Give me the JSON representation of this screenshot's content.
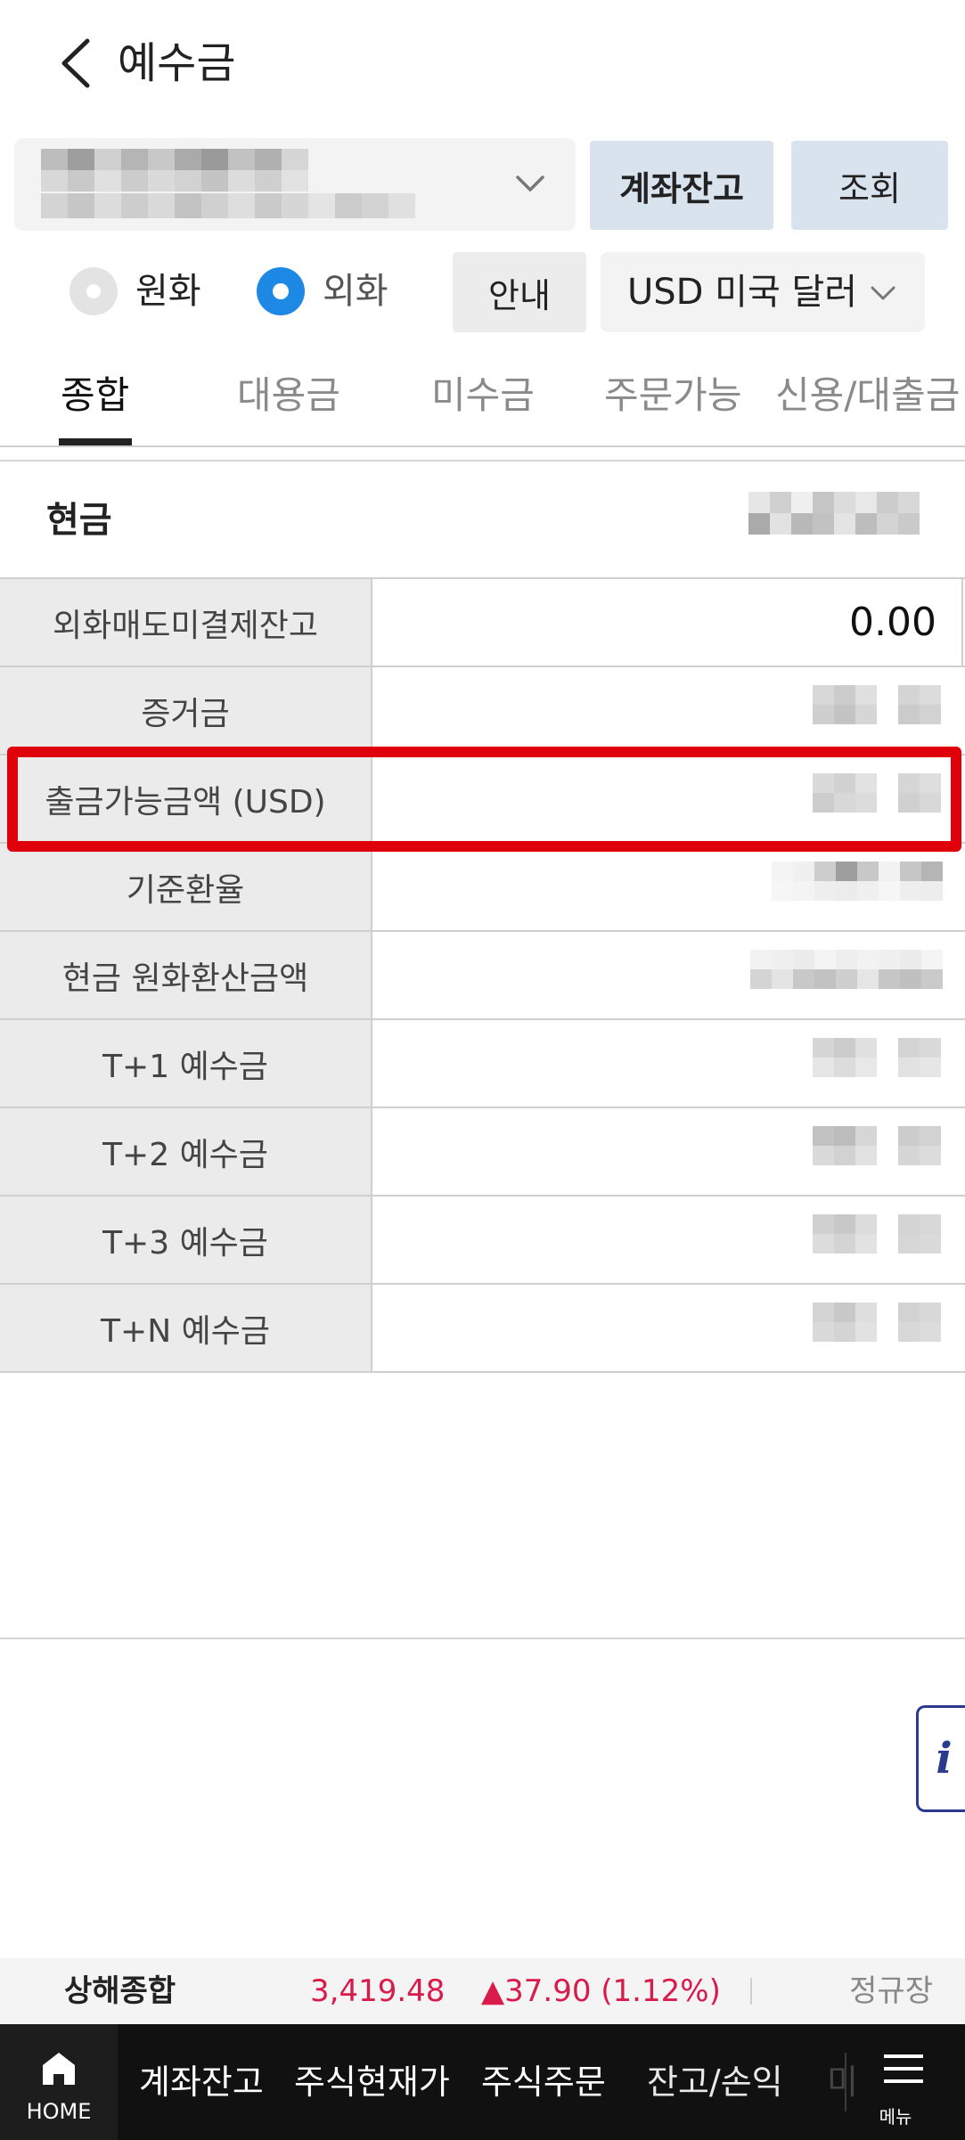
{
  "header": {
    "title": "예수금"
  },
  "account": {
    "blurred": true
  },
  "buttons": {
    "balance": "계좌잔고",
    "query": "조회",
    "guide": "안내"
  },
  "currency_mode": {
    "options": [
      {
        "label": "원화",
        "selected": false
      },
      {
        "label": "외화",
        "selected": true
      }
    ]
  },
  "currency_select": {
    "value": "USD 미국 달러"
  },
  "tabs": [
    {
      "label": "종합",
      "active": true
    },
    {
      "label": "대용금",
      "active": false
    },
    {
      "label": "미수금",
      "active": false
    },
    {
      "label": "주문가능",
      "active": false
    },
    {
      "label": "신용/대출금",
      "active": false
    }
  ],
  "cash": {
    "label": "현금"
  },
  "rows": [
    {
      "label": "외화매도미결제잔고",
      "value": "0.00"
    },
    {
      "label": "증거금",
      "value": ""
    },
    {
      "label": "출금가능금액 (USD)",
      "value": ""
    },
    {
      "label": "기준환율",
      "value": ""
    },
    {
      "label": "현금 원화환산금액",
      "value": ""
    },
    {
      "label": "T+1 예수금",
      "value": ""
    },
    {
      "label": "T+2 예수금",
      "value": ""
    },
    {
      "label": "T+3 예수금",
      "value": ""
    },
    {
      "label": "T+N 예수금",
      "value": ""
    }
  ],
  "info_button": {
    "label": "i"
  },
  "ticker": {
    "name": "상해종합",
    "value": "3,419.48",
    "change": "▲37.90 (1.12%)",
    "status": "정규장"
  },
  "bottom_nav": {
    "home_label": "HOME",
    "items": [
      "계좌잔고",
      "주식현재가",
      "주식주문",
      "잔고/손익",
      "미"
    ],
    "menu_label": "메뉴"
  },
  "colors": {
    "accent_blue": "#1e88e5",
    "button_bg": "#d9e3ee",
    "highlight_red": "#e0000c",
    "ticker_up": "#d81b4b",
    "nav_bg": "#111111"
  }
}
